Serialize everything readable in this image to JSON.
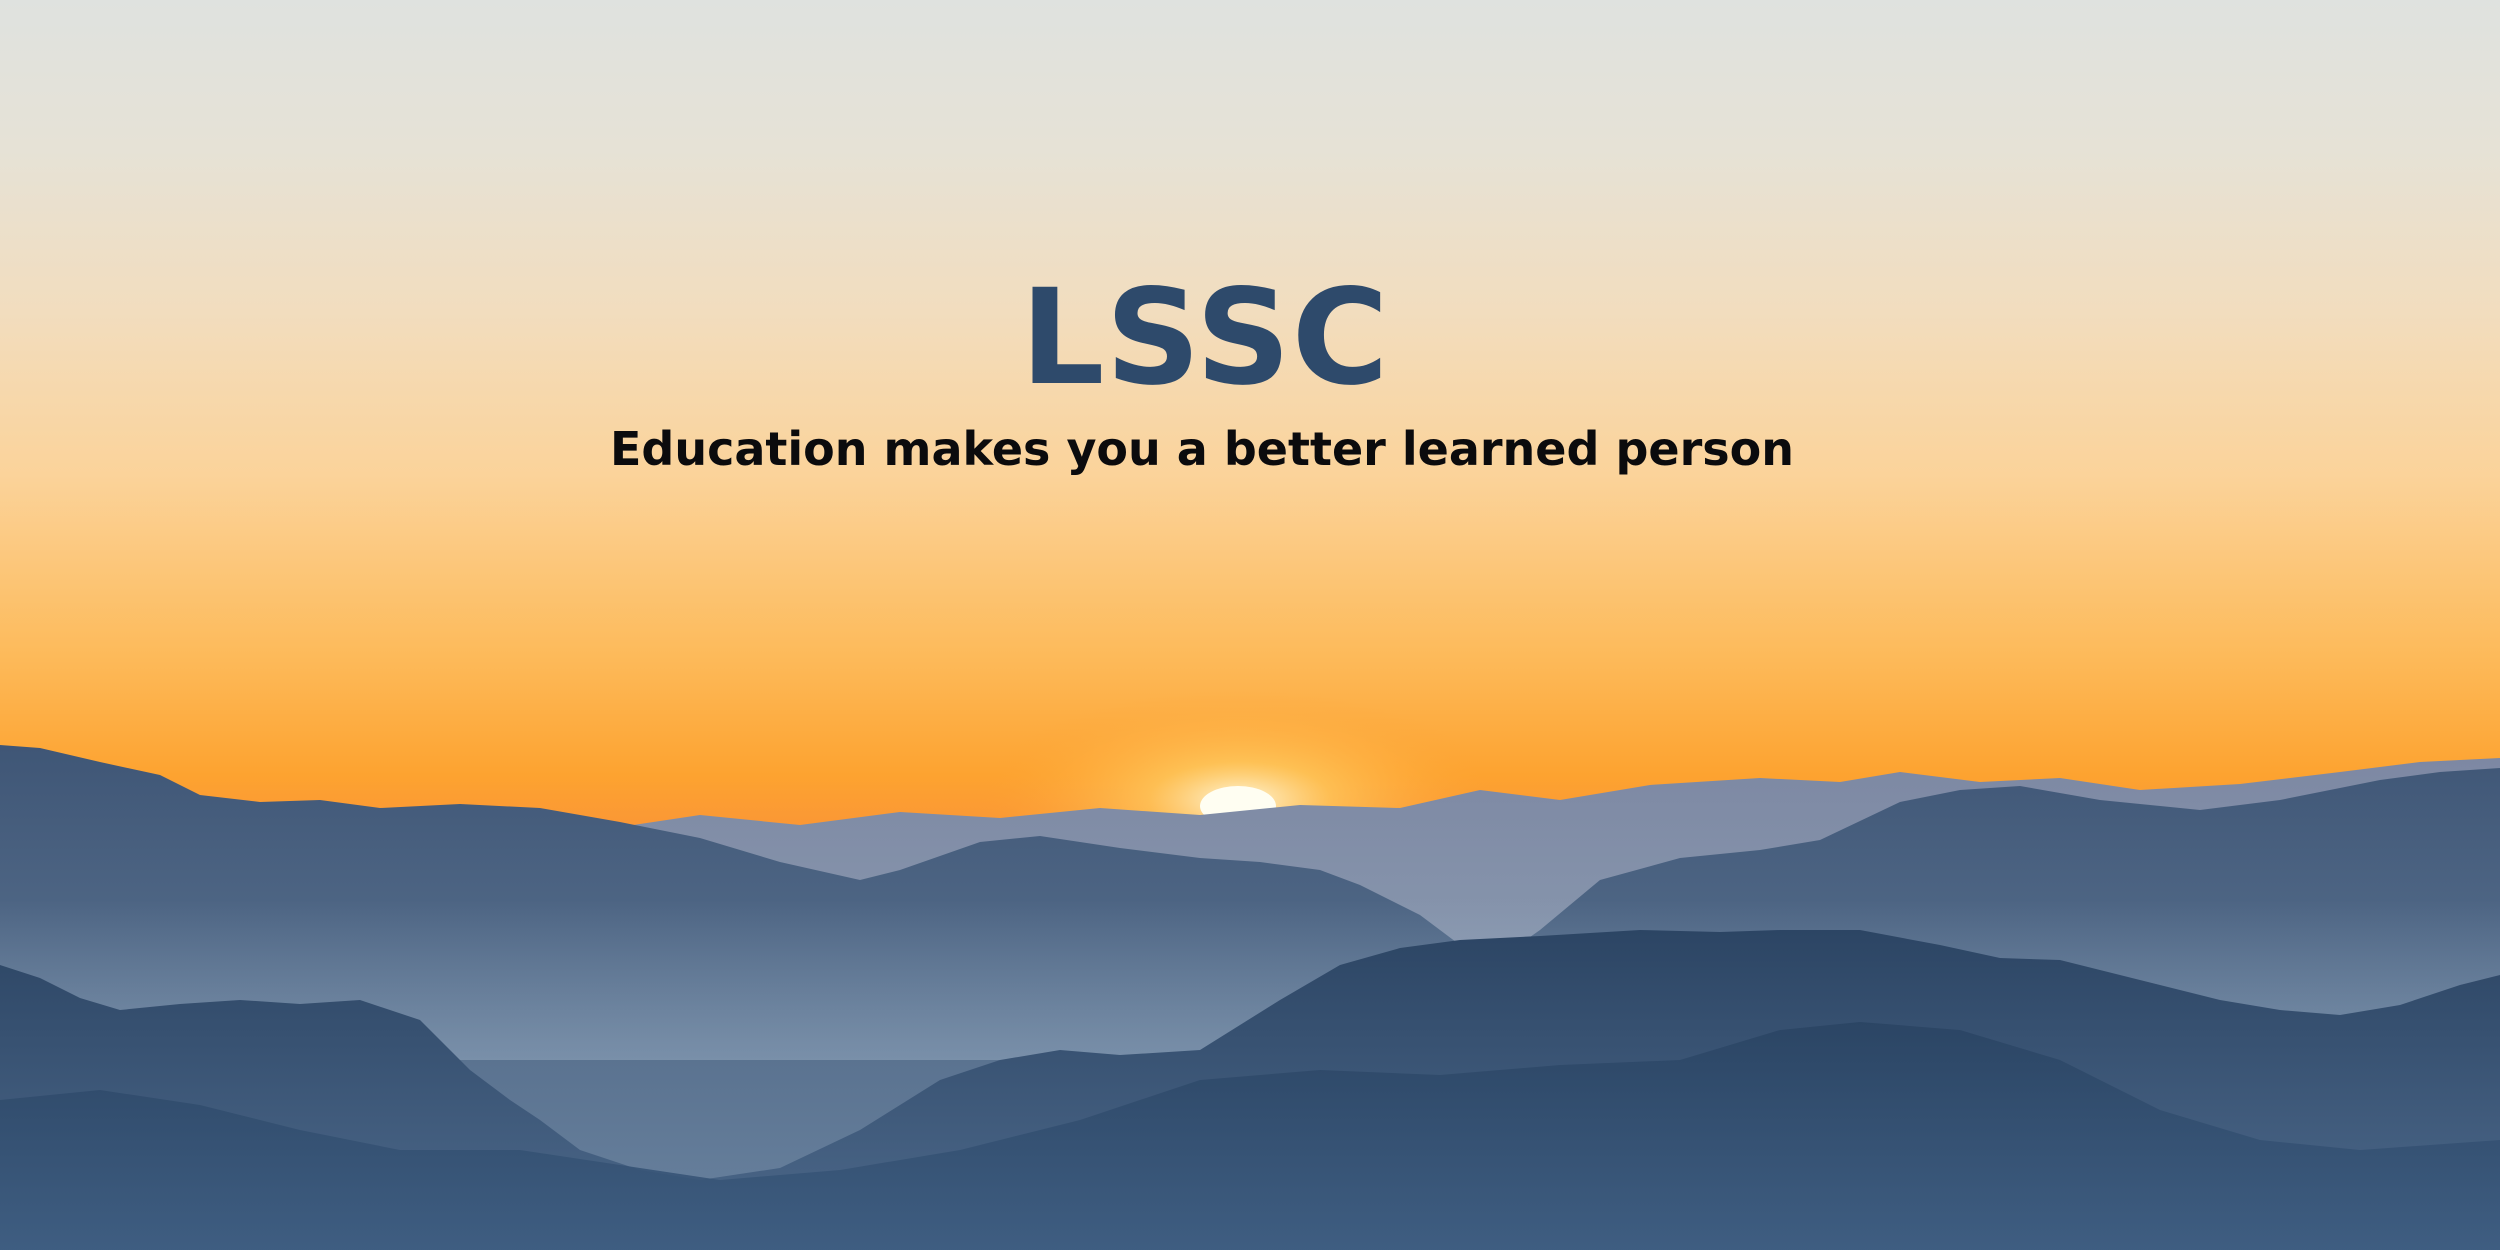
{
  "hero": {
    "title": "LSSC",
    "tagline": "Education makes you a better learned person"
  },
  "colors": {
    "sky_top": "#dfe2df",
    "sky_mid": "#fbd39a",
    "sky_horizon": "#fda330",
    "haze": "#ee7a55",
    "sun": "#fffef2",
    "ridge_far": "#7c8aa6",
    "ridge_mid": "#4f6584",
    "ridge_near": "#2c4564",
    "title_color": "#2e4a6b",
    "tagline_color": "#0b0b0d"
  },
  "scene": {
    "description_icon": "mountain-sunrise-illustration"
  }
}
